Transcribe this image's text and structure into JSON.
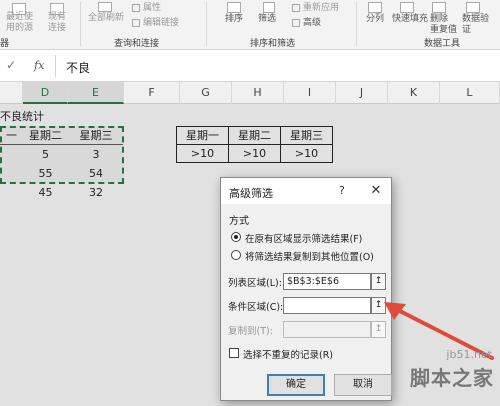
{
  "ribbon": {
    "group_get_data": {
      "label": "器",
      "recent_sources": "最近使\n用的源",
      "existing_connections": "现有\n连接"
    },
    "group_queries": {
      "label": "查询和连接",
      "refresh_all": "全部刷新",
      "properties": "属性",
      "edit_links": "编辑链接"
    },
    "group_sort_filter": {
      "label": "排序和筛选",
      "sort": "排序",
      "filter": "筛选",
      "reapply": "重新应用",
      "advanced": "高级"
    },
    "group_data_tools": {
      "label": "数据工具",
      "text_to_columns": "分列",
      "flash_fill": "快速填充",
      "remove_duplicates": "删除\n重复值",
      "data_validation": "数据验\n证"
    }
  },
  "formula_bar": {
    "check_glyph": "✓",
    "fx_label": "fx",
    "content": "不良"
  },
  "columns": [
    "D",
    "E",
    "F",
    "G",
    "H",
    "I",
    "J",
    "K",
    "L"
  ],
  "selected_columns": [
    "D",
    "E"
  ],
  "sheet": {
    "title_fragment": "不良统计",
    "source_table": {
      "headers": [
        "一",
        "星期二",
        "星期三"
      ],
      "rows": [
        [
          "",
          "5",
          "3"
        ],
        [
          "",
          "55",
          "54"
        ],
        [
          "",
          "45",
          "32"
        ]
      ]
    },
    "criteria_table": {
      "headers": [
        "星期一",
        "星期二",
        "星期三"
      ],
      "values": [
        ">10",
        ">10",
        ">10"
      ]
    }
  },
  "dialog": {
    "title": "高级筛选",
    "help": "?",
    "close": "✕",
    "section_label": "方式",
    "radio_in_place": "在原有区域显示筛选结果(F)",
    "radio_copy": "将筛选结果复制到其他位置(O)",
    "list_range_label": "列表区域(L):",
    "list_range_value": "$B$3:$E$6",
    "criteria_range_label": "条件区域(C):",
    "criteria_range_value": "",
    "copy_to_label": "复制到(T):",
    "copy_to_value": "",
    "collapse_glyph": "↥",
    "unique_records_label": "选择不重复的记录(R)",
    "ok_label": "确定",
    "cancel_label": "取消",
    "selected_mode": "in_place",
    "unique_checked": false
  },
  "watermark": {
    "site": "jb51.net",
    "brand": "脚本之家"
  },
  "colors": {
    "accent": "#217346",
    "arrow": "#e04a3a",
    "selection_fill": "#d9d9d9"
  }
}
